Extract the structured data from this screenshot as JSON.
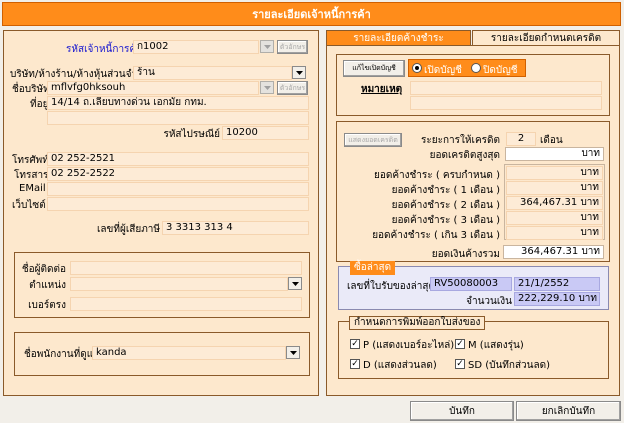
{
  "window": {
    "title": "รายละเอียดเจ้าหนี้การค้า"
  },
  "supplier": {
    "code_label": "รหัสเจ้าหนี้การค้า",
    "code_value": "ก1002",
    "code_btn": "ตัวอักษร",
    "company_type_label": "บริษัท/ห้างร้าน/ห้างหุ้นส่วนจำกัด",
    "company_type_value": "ร้าน",
    "company_name_label": "ชื่อบริษัท",
    "company_name_value": "mflvfg0hksouh",
    "company_name_btn": "ตัวอักษร",
    "address_label": "ที่อยู่",
    "address_value": "14/14 ถ.เลียบทางด่วน เอกมัย กทม.",
    "postcode_label": "รหัสไปรษณีย์",
    "postcode_value": "10200",
    "phone_label": "โทรศัพท์",
    "phone_value": "02 252-2521",
    "fax_label": "โทรสาร",
    "fax_value": "02 252-2522",
    "email_label": "EMail",
    "email_value": "",
    "website_label": "เว็บไซต์",
    "website_value": "",
    "taxid_label": "เลขที่ผู้เสียภาษี",
    "taxid_value": "3 3313 313 4"
  },
  "contact": {
    "name_label": "ชื่อผู้ติดต่อ",
    "position_label": "ตำแหน่ง",
    "direct_phone_label": "เบอร์ตรง"
  },
  "staff": {
    "label": "ชื่อพนักงานที่ดูแล",
    "value": "kanda"
  },
  "tabs": [
    {
      "label": "รายละเอียดค้างชำระ",
      "active": true
    },
    {
      "label": "รายละเอียดกำหนดเครดิต",
      "active": false
    }
  ],
  "account": {
    "edit_btn": "แก้ไขเปิดบัญชี",
    "open_label": "เปิดบัญชี",
    "close_label": "ปิดบัญชี",
    "note_label": "หมายเหตุ"
  },
  "credit": {
    "show_btn": "แสดงยอดเครดิต",
    "term_label": "ระยะการให้เครดิต",
    "term_value": "2",
    "term_unit": "เดือน",
    "max_label": "ยอดเครดิตสูงสุด",
    "max_value": "",
    "currency": "บาท"
  },
  "outstanding": {
    "rows": [
      {
        "label": "ยอดค้างชำระ ( ครบกำหนด )",
        "value": ""
      },
      {
        "label": "ยอดค้างชำระ  ( 1 เดือน  )",
        "value": ""
      },
      {
        "label": "ยอดค้างชำระ  ( 2 เดือน  )",
        "value": "364,467.31"
      },
      {
        "label": "ยอดค้างชำระ  ( 3 เดือน  )",
        "value": ""
      },
      {
        "label": "ยอดค้างชำระ ( เกิน 3 เดือน )",
        "value": ""
      }
    ],
    "total_label": "ยอดเงินค้างรวม",
    "total_value": "364,467.31",
    "currency": "บาท"
  },
  "last_purchase": {
    "caption": "ซื้อล่าสุด",
    "doc_label": "เลขที่ใบรับของล่าสุด",
    "doc_value": "RV50080003",
    "date_value": "21/1/2552",
    "amount_label": "จำนวนเงิน",
    "amount_value": "222,229.10",
    "currency": "บาท"
  },
  "print_options": {
    "caption": "กำหนดการพิมพ์ออกใบส่งของ",
    "items": [
      {
        "label": "P (แสดงเบอร์อะไหล่)",
        "checked": true
      },
      {
        "label": "M (แสดงรุ่น)",
        "checked": true
      },
      {
        "label": "D (แสดงส่วนลด)",
        "checked": true
      },
      {
        "label": "SD (บันทึกส่วนลด)",
        "checked": true
      }
    ]
  },
  "footer": {
    "save_btn": "บันทึก",
    "cancel_btn": "ยกเลิกบันทึก"
  },
  "colors": {
    "title_bar": "#ff8c1a",
    "panel_bg": "#fde8cd",
    "highlight_blue": "#c9c9f5"
  }
}
